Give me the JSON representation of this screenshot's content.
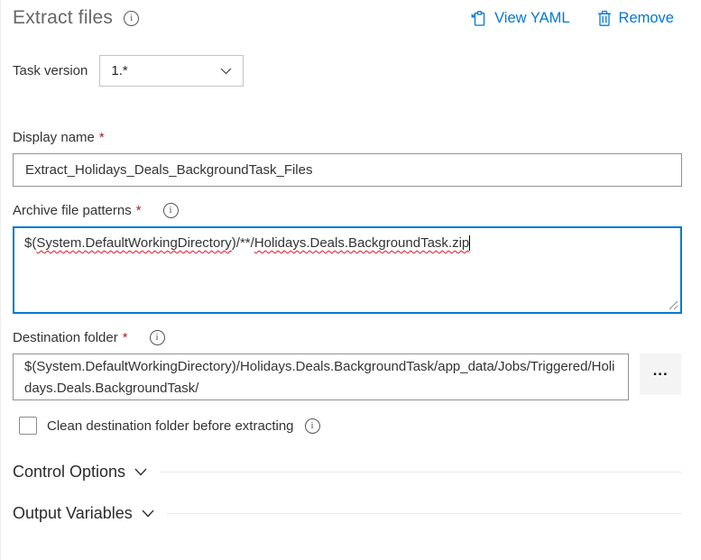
{
  "header": {
    "title": "Extract files",
    "view_yaml_label": "View YAML",
    "remove_label": "Remove"
  },
  "icons": {
    "info_glyph": "i",
    "browse_glyph": "..."
  },
  "task_version": {
    "label": "Task version",
    "value": "1.*"
  },
  "fields": {
    "display_name": {
      "label": "Display name",
      "required": "*",
      "value": "Extract_Holidays_Deals_BackgroundTask_Files"
    },
    "archive_patterns": {
      "label": "Archive file patterns",
      "required": "*",
      "segments": [
        {
          "text": "$("
        },
        {
          "text": "System.DefaultWorkingDirectory"
        },
        {
          "text": ")/**/"
        },
        {
          "text": "Holidays.Deals.BackgroundTask.zip"
        }
      ]
    },
    "destination_folder": {
      "label": "Destination folder",
      "required": "*",
      "value": "$(System.DefaultWorkingDirectory)/Holidays.Deals.BackgroundTask/app_data/Jobs/Triggered/Holidays.Deals.BackgroundTask/"
    },
    "clean_destination": {
      "label": "Clean destination folder before extracting",
      "checked": false
    }
  },
  "sections": [
    {
      "label": "Control Options"
    },
    {
      "label": "Output Variables"
    }
  ],
  "colors": {
    "link_blue": "#0078d4",
    "focus_border_blue": "#0078d4",
    "required_red": "#a4262c",
    "spellcheck_red": "#e81123"
  }
}
